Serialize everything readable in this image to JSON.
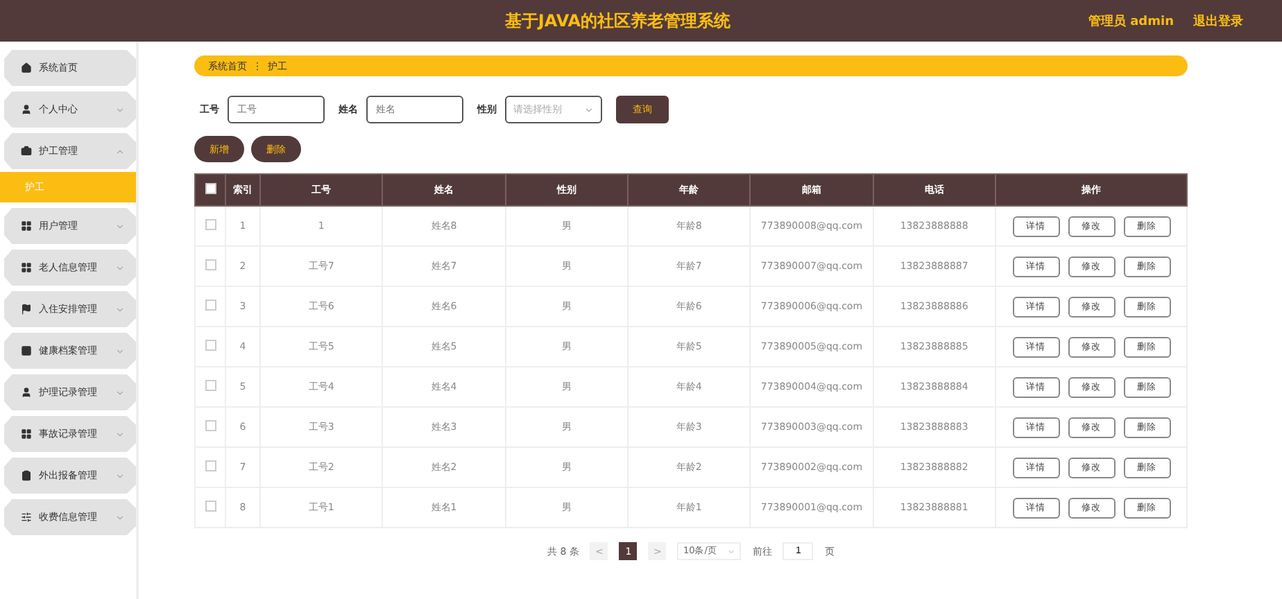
{
  "header": {
    "title": "基于JAVA的社区养老管理系统",
    "user": "管理员 admin",
    "logout": "退出登录"
  },
  "sidebar": {
    "items": [
      {
        "label": "系统首页",
        "kind": "link"
      },
      {
        "label": "个人中心",
        "kind": "group",
        "expanded": false
      },
      {
        "label": "护工管理",
        "kind": "group",
        "expanded": true,
        "children": [
          {
            "label": "护工",
            "selected": true
          }
        ]
      },
      {
        "label": "用户管理",
        "kind": "group",
        "expanded": false
      },
      {
        "label": "老人信息管理",
        "kind": "group",
        "expanded": false
      },
      {
        "label": "入住安排管理",
        "kind": "group",
        "expanded": false
      },
      {
        "label": "健康档案管理",
        "kind": "group",
        "expanded": false
      },
      {
        "label": "护理记录管理",
        "kind": "group",
        "expanded": false
      },
      {
        "label": "事故记录管理",
        "kind": "group",
        "expanded": false
      },
      {
        "label": "外出报备管理",
        "kind": "group",
        "expanded": false
      },
      {
        "label": "收费信息管理",
        "kind": "group",
        "expanded": false
      }
    ]
  },
  "breadcrumb": [
    "系统首页",
    "护工"
  ],
  "breadcrumb_separator": "⋮",
  "filters": [
    {
      "label": "工号",
      "placeholder": "工号",
      "kind": "text"
    },
    {
      "label": "姓名",
      "placeholder": "姓名",
      "kind": "text"
    },
    {
      "label": "性别",
      "placeholder": "请选择性别",
      "kind": "select"
    }
  ],
  "search_button": "查询",
  "actions": [
    "新增",
    "删除"
  ],
  "table": {
    "columns": [
      "索引",
      "工号",
      "姓名",
      "性别",
      "年龄",
      "邮箱",
      "电话",
      "操作"
    ],
    "all_checked": false,
    "rows": [
      {
        "checked": false,
        "cells": [
          "1",
          "1",
          "姓名8",
          "男",
          "年龄8",
          "773890008@qq.com",
          "13823888888"
        ],
        "actions": [
          "详情",
          "修改",
          "删除"
        ]
      },
      {
        "checked": false,
        "cells": [
          "2",
          "工号7",
          "姓名7",
          "男",
          "年龄7",
          "773890007@qq.com",
          "13823888887"
        ],
        "actions": [
          "详情",
          "修改",
          "删除"
        ]
      },
      {
        "checked": false,
        "cells": [
          "3",
          "工号6",
          "姓名6",
          "男",
          "年龄6",
          "773890006@qq.com",
          "13823888886"
        ],
        "actions": [
          "详情",
          "修改",
          "删除"
        ]
      },
      {
        "checked": false,
        "cells": [
          "4",
          "工号5",
          "姓名5",
          "男",
          "年龄5",
          "773890005@qq.com",
          "13823888885"
        ],
        "actions": [
          "详情",
          "修改",
          "删除"
        ]
      },
      {
        "checked": false,
        "cells": [
          "5",
          "工号4",
          "姓名4",
          "男",
          "年龄4",
          "773890004@qq.com",
          "13823888884"
        ],
        "actions": [
          "详情",
          "修改",
          "删除"
        ]
      },
      {
        "checked": false,
        "cells": [
          "6",
          "工号3",
          "姓名3",
          "男",
          "年龄3",
          "773890003@qq.com",
          "13823888883"
        ],
        "actions": [
          "详情",
          "修改",
          "删除"
        ]
      },
      {
        "checked": false,
        "cells": [
          "7",
          "工号2",
          "姓名2",
          "男",
          "年龄2",
          "773890002@qq.com",
          "13823888882"
        ],
        "actions": [
          "详情",
          "修改",
          "删除"
        ]
      },
      {
        "checked": false,
        "cells": [
          "8",
          "工号1",
          "姓名1",
          "男",
          "年龄1",
          "773890001@qq.com",
          "13823888881"
        ],
        "actions": [
          "详情",
          "修改",
          "删除"
        ]
      }
    ]
  },
  "pagination": {
    "total": "共 8 条",
    "prev": "<",
    "pages": [
      {
        "label": "1",
        "selected": true
      }
    ],
    "next": ">",
    "page_size": "10条/页",
    "goto_label": "前往",
    "goto_value": "1",
    "goto_suffix": "页"
  }
}
